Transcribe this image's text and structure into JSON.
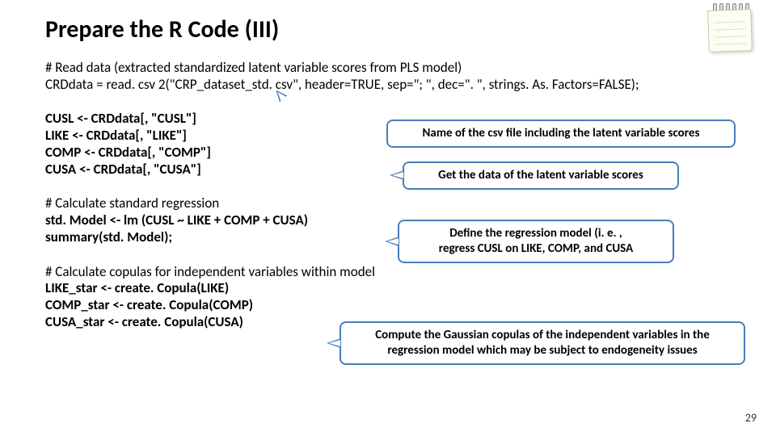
{
  "title": "Prepare the R Code (III)",
  "page_number": "29",
  "block1": {
    "l1": "# Read data (extracted standardized latent variable scores from PLS model)",
    "l2": "CRDdata = read. csv 2(\"CRP_dataset_std. csv\", header=TRUE, sep=\"; \", dec=\". \", strings. As. Factors=FALSE);"
  },
  "block2": {
    "l1": "CUSL <- CRDdata[, \"CUSL\"]",
    "l2": "LIKE <- CRDdata[, \"LIKE\"]",
    "l3": "COMP <- CRDdata[, \"COMP\"]",
    "l4": "CUSA <- CRDdata[, \"CUSA\"]"
  },
  "block3": {
    "l1": "# Calculate standard regression",
    "l2": "std. Model <- lm (CUSL ~ LIKE + COMP + CUSA)",
    "l3": "summary(std. Model);"
  },
  "block4": {
    "l1": "# Calculate copulas for independent variables within model",
    "l2": "LIKE_star <- create. Copula(LIKE)",
    "l3": "COMP_star <- create. Copula(COMP)",
    "l4": "CUSA_star <- create. Copula(CUSA)"
  },
  "callouts": {
    "c1": "Name of the csv file including the latent variable scores",
    "c2": "Get the data of the latent variable scores",
    "c3a": "Define the regression model (i. e. ,",
    "c3b": "regress CUSL on LIKE, COMP, and CUSA",
    "c4a": "Compute the Gaussian copulas of the independent variables in the",
    "c4b": "regression model which may be subject to endogeneity issues"
  }
}
